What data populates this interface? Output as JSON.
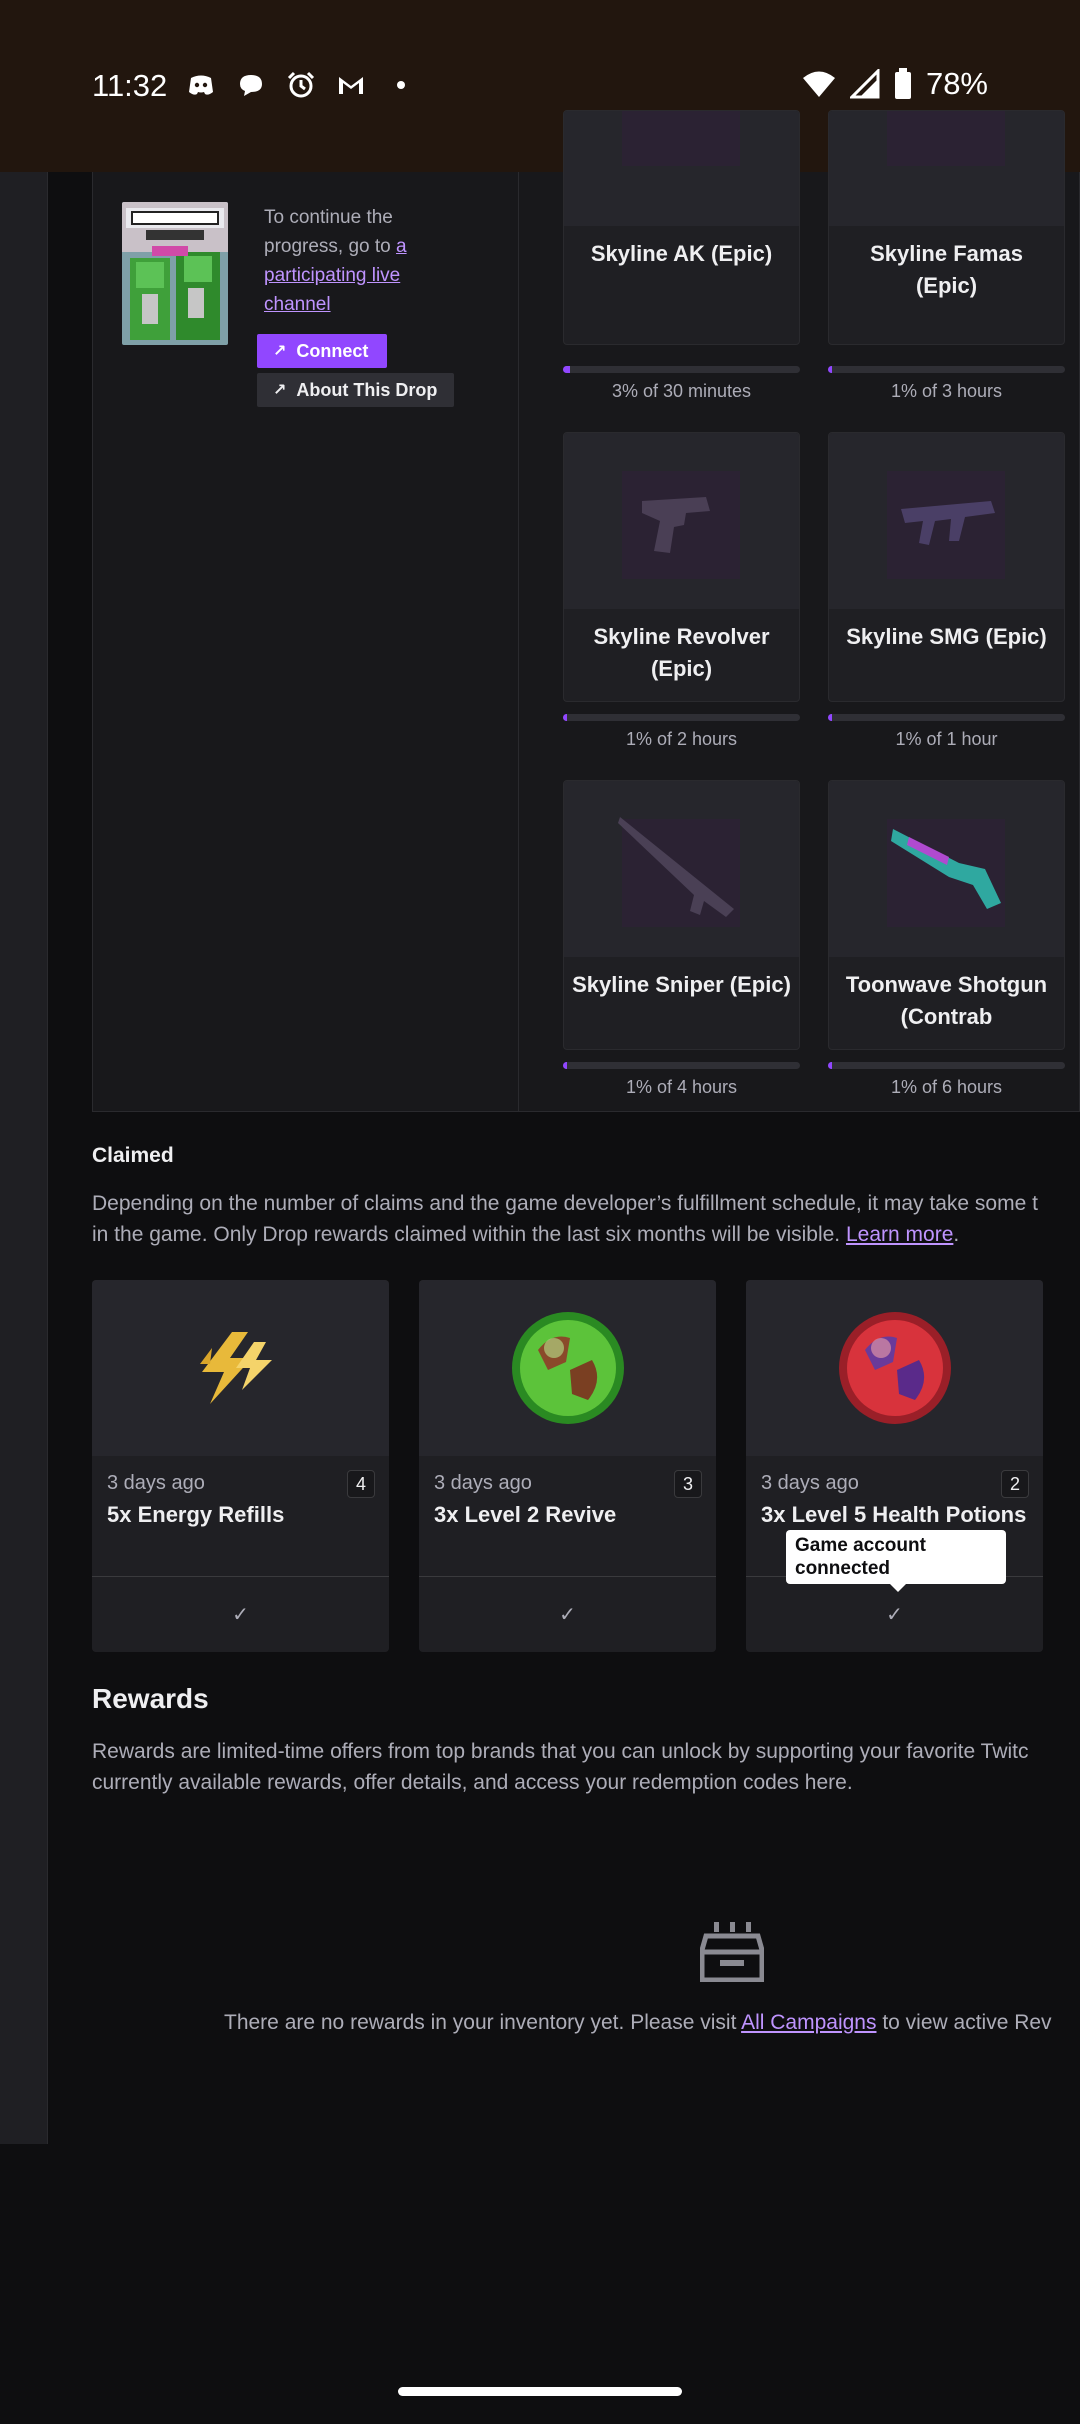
{
  "status_bar": {
    "time": "11:32",
    "notification_icons": [
      "discord-icon",
      "chat-bubble-icon",
      "alarm-icon",
      "gmail-icon",
      "dot-icon"
    ],
    "battery_percent": "78%"
  },
  "campaign": {
    "continue_prefix": "To continue the progress, go to ",
    "continue_link": "a participating live channel",
    "connect_label": "Connect",
    "about_label": "About This Drop",
    "drops": [
      {
        "name": "Skyline AK (Epic)",
        "progress_text": "3% of 30 minutes",
        "progress": 0.03
      },
      {
        "name": "Skyline Famas (Epic)",
        "progress_text": "1% of 3 hours",
        "progress": 0.01
      },
      {
        "name": "Skyline Revolver (Epic)",
        "progress_text": "1% of 2 hours",
        "progress": 0.01
      },
      {
        "name": "Skyline SMG (Epic)",
        "progress_text": "1% of 1 hour",
        "progress": 0.01
      },
      {
        "name": "Skyline Sniper (Epic)",
        "progress_text": "1% of 4 hours",
        "progress": 0.01
      },
      {
        "name": "Toonwave Shotgun (Contrab",
        "progress_text": "1% of 6 hours",
        "progress": 0.01
      }
    ]
  },
  "claimed": {
    "title": "Claimed",
    "desc_line1": "Depending on the number of claims and the game developer’s fulfillment schedule, it may take some t",
    "desc_line2_prefix": "in the game. Only Drop rewards claimed within the last six months will be visible. ",
    "learn_more": "Learn more",
    "desc_line2_suffix": ".",
    "items": [
      {
        "time": "3 days ago",
        "count": "4",
        "title": "5x Energy Refills"
      },
      {
        "time": "3 days ago",
        "count": "3",
        "title": "3x Level 2 Revive"
      },
      {
        "time": "3 days ago",
        "count": "2",
        "title": "3x Level 5 Health Potions"
      }
    ],
    "tooltip": "Game account connected"
  },
  "rewards": {
    "title": "Rewards",
    "desc_line1": "Rewards are limited-time offers from top brands that you can unlock by supporting your favorite Twitc",
    "desc_line2": "currently available rewards, offer details, and access your redemption codes here.",
    "empty_prefix": "There are no rewards in your inventory yet. Please visit ",
    "empty_link": "All Campaigns",
    "empty_suffix": " to view active Rev"
  }
}
